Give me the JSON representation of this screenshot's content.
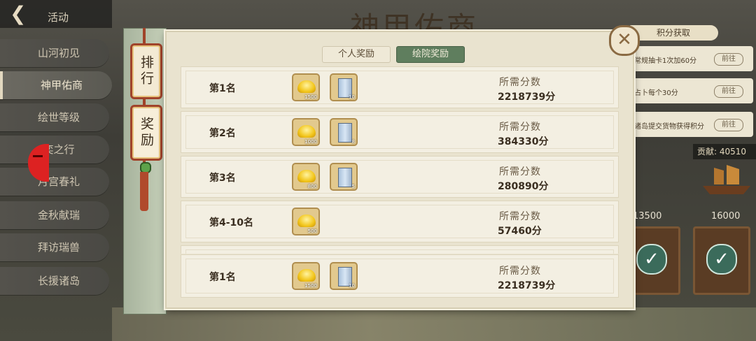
{
  "background": {
    "title": "神甲佑商"
  },
  "topbar": {
    "back_icon": "chevron-left-icon",
    "title": "活动"
  },
  "sidebar": {
    "items": [
      {
        "label": "山河初见"
      },
      {
        "label": "神甲佑商",
        "active": true
      },
      {
        "label": "绘世等级"
      },
      {
        "label": "奕之行"
      },
      {
        "label": "月宫春礼"
      },
      {
        "label": "金秋献瑞"
      },
      {
        "label": "拜访瑞兽"
      },
      {
        "label": "长援诸岛"
      }
    ]
  },
  "right_panel": {
    "header": "积分获取",
    "rows": [
      {
        "text": "常规抽卡1次加60分",
        "go": "前往"
      },
      {
        "text": "占卜每个30分",
        "go": "前往"
      },
      {
        "text": "诸岛提交货物获得积分",
        "go": "前往"
      }
    ],
    "contribution": "贡献: 40510",
    "score_labels": [
      "13500",
      "16000"
    ]
  },
  "scroll": {
    "tabs": [
      {
        "label": "排行"
      },
      {
        "label": "奖励",
        "active": true
      }
    ]
  },
  "tabs": {
    "personal": "个人奖励",
    "academy": "绘院奖励",
    "active": "academy"
  },
  "rewards": [
    {
      "rank": "第1名",
      "items": [
        {
          "icon": "gold-ingot-icon",
          "count": "1500"
        },
        {
          "icon": "scroll-book-icon",
          "count": "10"
        }
      ],
      "req_label": "所需分数",
      "req_value": "2218739分"
    },
    {
      "rank": "第2名",
      "items": [
        {
          "icon": "gold-ingot-icon",
          "count": "1000"
        },
        {
          "icon": "scroll-book-icon",
          "count": "8"
        }
      ],
      "req_label": "所需分数",
      "req_value": "384330分"
    },
    {
      "rank": "第3名",
      "items": [
        {
          "icon": "gold-ingot-icon",
          "count": "800"
        },
        {
          "icon": "scroll-book-icon",
          "count": "5"
        }
      ],
      "req_label": "所需分数",
      "req_value": "280890分"
    },
    {
      "rank": "第4-10名",
      "items": [
        {
          "icon": "gold-ingot-icon",
          "count": "500"
        }
      ],
      "req_label": "所需分数",
      "req_value": "57460分"
    }
  ],
  "my_reward": {
    "rank": "第1名",
    "items": [
      {
        "icon": "gold-ingot-icon",
        "count": "1500"
      },
      {
        "icon": "scroll-book-icon",
        "count": "10"
      }
    ],
    "req_label": "所需分数",
    "req_value": "2218739分"
  },
  "close_icon": "close-icon"
}
